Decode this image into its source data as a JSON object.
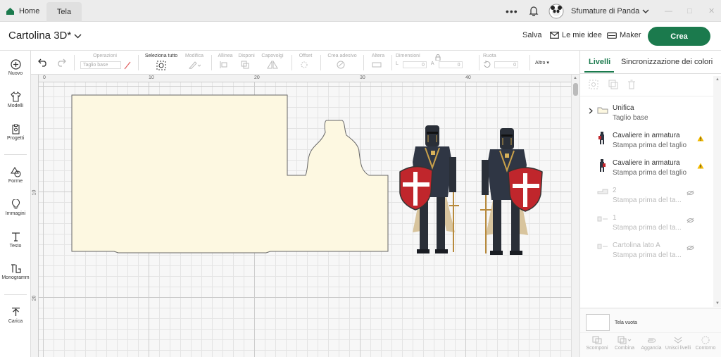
{
  "titlebar": {
    "home": "Home",
    "tab": "Tela",
    "user": "Sfumature di Panda"
  },
  "header": {
    "title": "Cartolina 3D*",
    "save": "Salva",
    "ideas": "Le mie idee",
    "maker": "Maker",
    "create": "Crea"
  },
  "toolbar": {
    "operations": "Operazioni",
    "operation_value": "Taglio base",
    "select_all": "Seleziona tutto",
    "edit": "Modifica",
    "align": "Allinea",
    "arrange": "Disponi",
    "flip": "Capovolgi",
    "offset": "Offset",
    "warp": "Crea adesivo",
    "size": "Dimensioni",
    "rotate": "Ruota",
    "more": "Altro",
    "size_w_label": "L",
    "size_h_label": "A",
    "size_w": "0",
    "size_h": "0",
    "rotate_value": "0"
  },
  "leftbar": [
    {
      "label": "Nuovo"
    },
    {
      "label": "Modelli"
    },
    {
      "label": "Progetti"
    },
    {
      "label": "Forme"
    },
    {
      "label": "Immagini"
    },
    {
      "label": "Testo"
    },
    {
      "label": "Monogramm"
    },
    {
      "label": "Carica"
    }
  ],
  "rulers": {
    "top": [
      "0",
      "10",
      "20",
      "30",
      "40"
    ],
    "left": [
      "10",
      "20"
    ]
  },
  "panel": {
    "tabs": [
      "Livelli",
      "Sincronizzazione dei colori"
    ],
    "layers": [
      {
        "name": "Unifica",
        "sub": "Taglio base"
      },
      {
        "name": "Cavaliere in armatura",
        "sub": "Stampa prima del taglio"
      },
      {
        "name": "Cavaliere in armatura",
        "sub": "Stampa prima del taglio"
      },
      {
        "name": "2",
        "sub": "Stampa prima del ta..."
      },
      {
        "name": "1",
        "sub": "Stampa prima del ta..."
      },
      {
        "name": "Cartolina lato A",
        "sub": "Stampa prima del ta..."
      }
    ],
    "blank_canvas": "Tela vuota",
    "actions": [
      "Scomponi",
      "Combina",
      "Aggancia",
      "Unisci livelli",
      "Contorno"
    ]
  },
  "colors": {
    "accent": "#1b7a4d",
    "card": "#fdf8e1",
    "shield": "#c0262c"
  }
}
